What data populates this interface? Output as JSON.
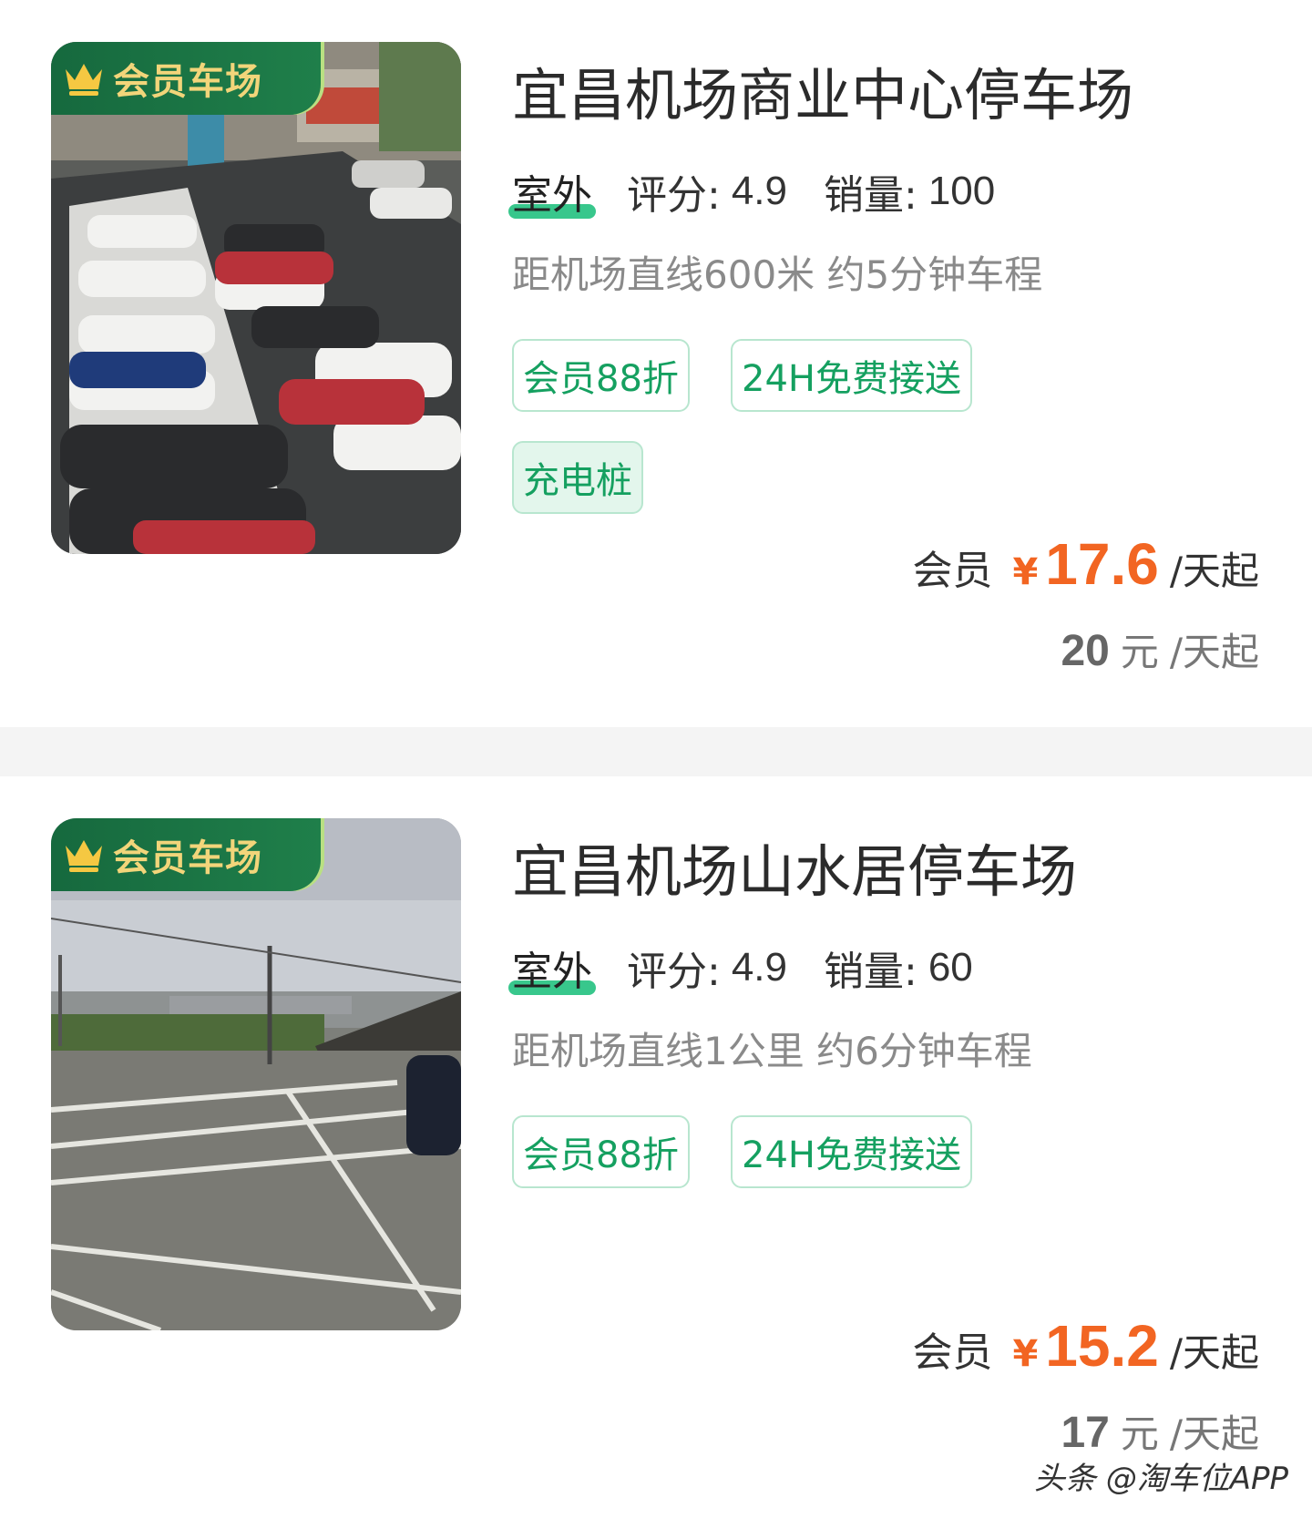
{
  "listings": [
    {
      "badge": "会员车场",
      "title": "宜昌机场商业中心停车场",
      "type": "室外",
      "rating_label": "评分:",
      "rating": "4.9",
      "sales_label": "销量:",
      "sales": "100",
      "distance": "距机场直线600米 约5分钟车程",
      "tags": [
        "会员88折",
        "24H免费接送",
        "充电桩"
      ],
      "price_label": "会员",
      "currency": "¥",
      "member_price": "17.6",
      "price_unit": "/天起",
      "original_price": "20",
      "original_currency": "元",
      "original_unit": "/天起"
    },
    {
      "badge": "会员车场",
      "title": "宜昌机场山水居停车场",
      "type": "室外",
      "rating_label": "评分:",
      "rating": "4.9",
      "sales_label": "销量:",
      "sales": "60",
      "distance": "距机场直线1公里 约6分钟车程",
      "tags": [
        "会员88折",
        "24H免费接送"
      ],
      "price_label": "会员",
      "currency": "¥",
      "member_price": "15.2",
      "price_unit": "/天起",
      "original_price": "17",
      "original_currency": "元",
      "original_unit": "/天起"
    }
  ],
  "watermark": "头条 @淘车位APP",
  "colors": {
    "accent_green": "#15a060",
    "badge_green": "#16693e",
    "badge_gold": "#f2d57a",
    "price_orange": "#f26522"
  },
  "icons": {
    "badge_icon": "crown-icon"
  }
}
